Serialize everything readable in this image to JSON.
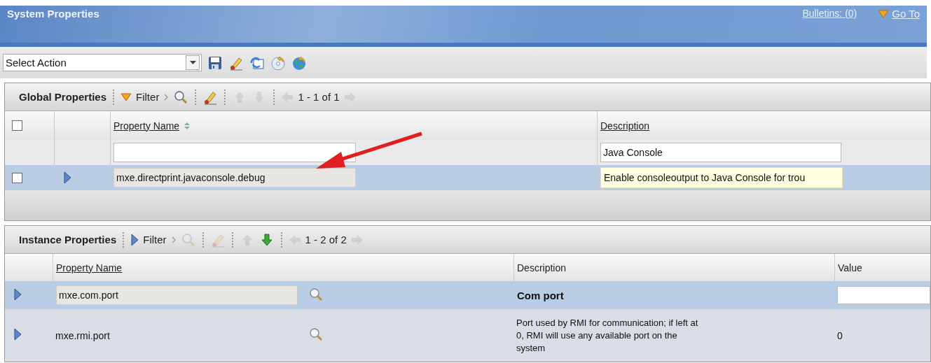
{
  "window": {
    "title": "System Properties"
  },
  "header_links": [
    {
      "kind": "bulletins",
      "label": "Bulletins: (0)"
    },
    {
      "kind": "goto",
      "label": "Go To"
    }
  ],
  "action_select": {
    "value": "Select Action"
  },
  "toolbar_icons": [
    {
      "kind": "save"
    },
    {
      "kind": "eraser"
    },
    {
      "kind": "refresh"
    },
    {
      "kind": "disc"
    },
    {
      "kind": "globe"
    }
  ],
  "global_properties": {
    "title": "Global Properties",
    "filter_label": "Filter",
    "filter_expanded": true,
    "pager": "1 - 1 of 1",
    "tools": [
      {
        "kind": "search",
        "disabled": false
      },
      {
        "kind": "eraser",
        "disabled": false
      },
      {
        "kind": "up",
        "disabled": true
      },
      {
        "kind": "down",
        "disabled": true
      }
    ],
    "header_checked": false,
    "columns": [
      "Property Name",
      "Description"
    ],
    "filters": {
      "description": "Java Console"
    },
    "rows": [
      {
        "property_name": "mxe.directprint.javaconsole.debug",
        "description": "Enable consoleoutput to Java Console for trou",
        "checked": false,
        "selected": true
      }
    ]
  },
  "instance_properties": {
    "title": "Instance Properties",
    "filter_label": "Filter",
    "filter_expanded": false,
    "pager": "1 - 2 of 2",
    "tools": [
      {
        "kind": "search",
        "disabled": true
      },
      {
        "kind": "eraser",
        "disabled": true
      },
      {
        "kind": "up",
        "disabled": true
      },
      {
        "kind": "down",
        "disabled": false
      }
    ],
    "columns": [
      "Property Name",
      "Description",
      "Value"
    ],
    "rows": [
      {
        "property_name": "mxe.com.port",
        "description": "Com port",
        "value": null,
        "selected": true
      },
      {
        "property_name": "mxe.rmi.port",
        "description": "Port used by RMI for communication; if left at 0, RMI will use any available port on the system",
        "value": "0",
        "selected": false
      }
    ]
  }
}
